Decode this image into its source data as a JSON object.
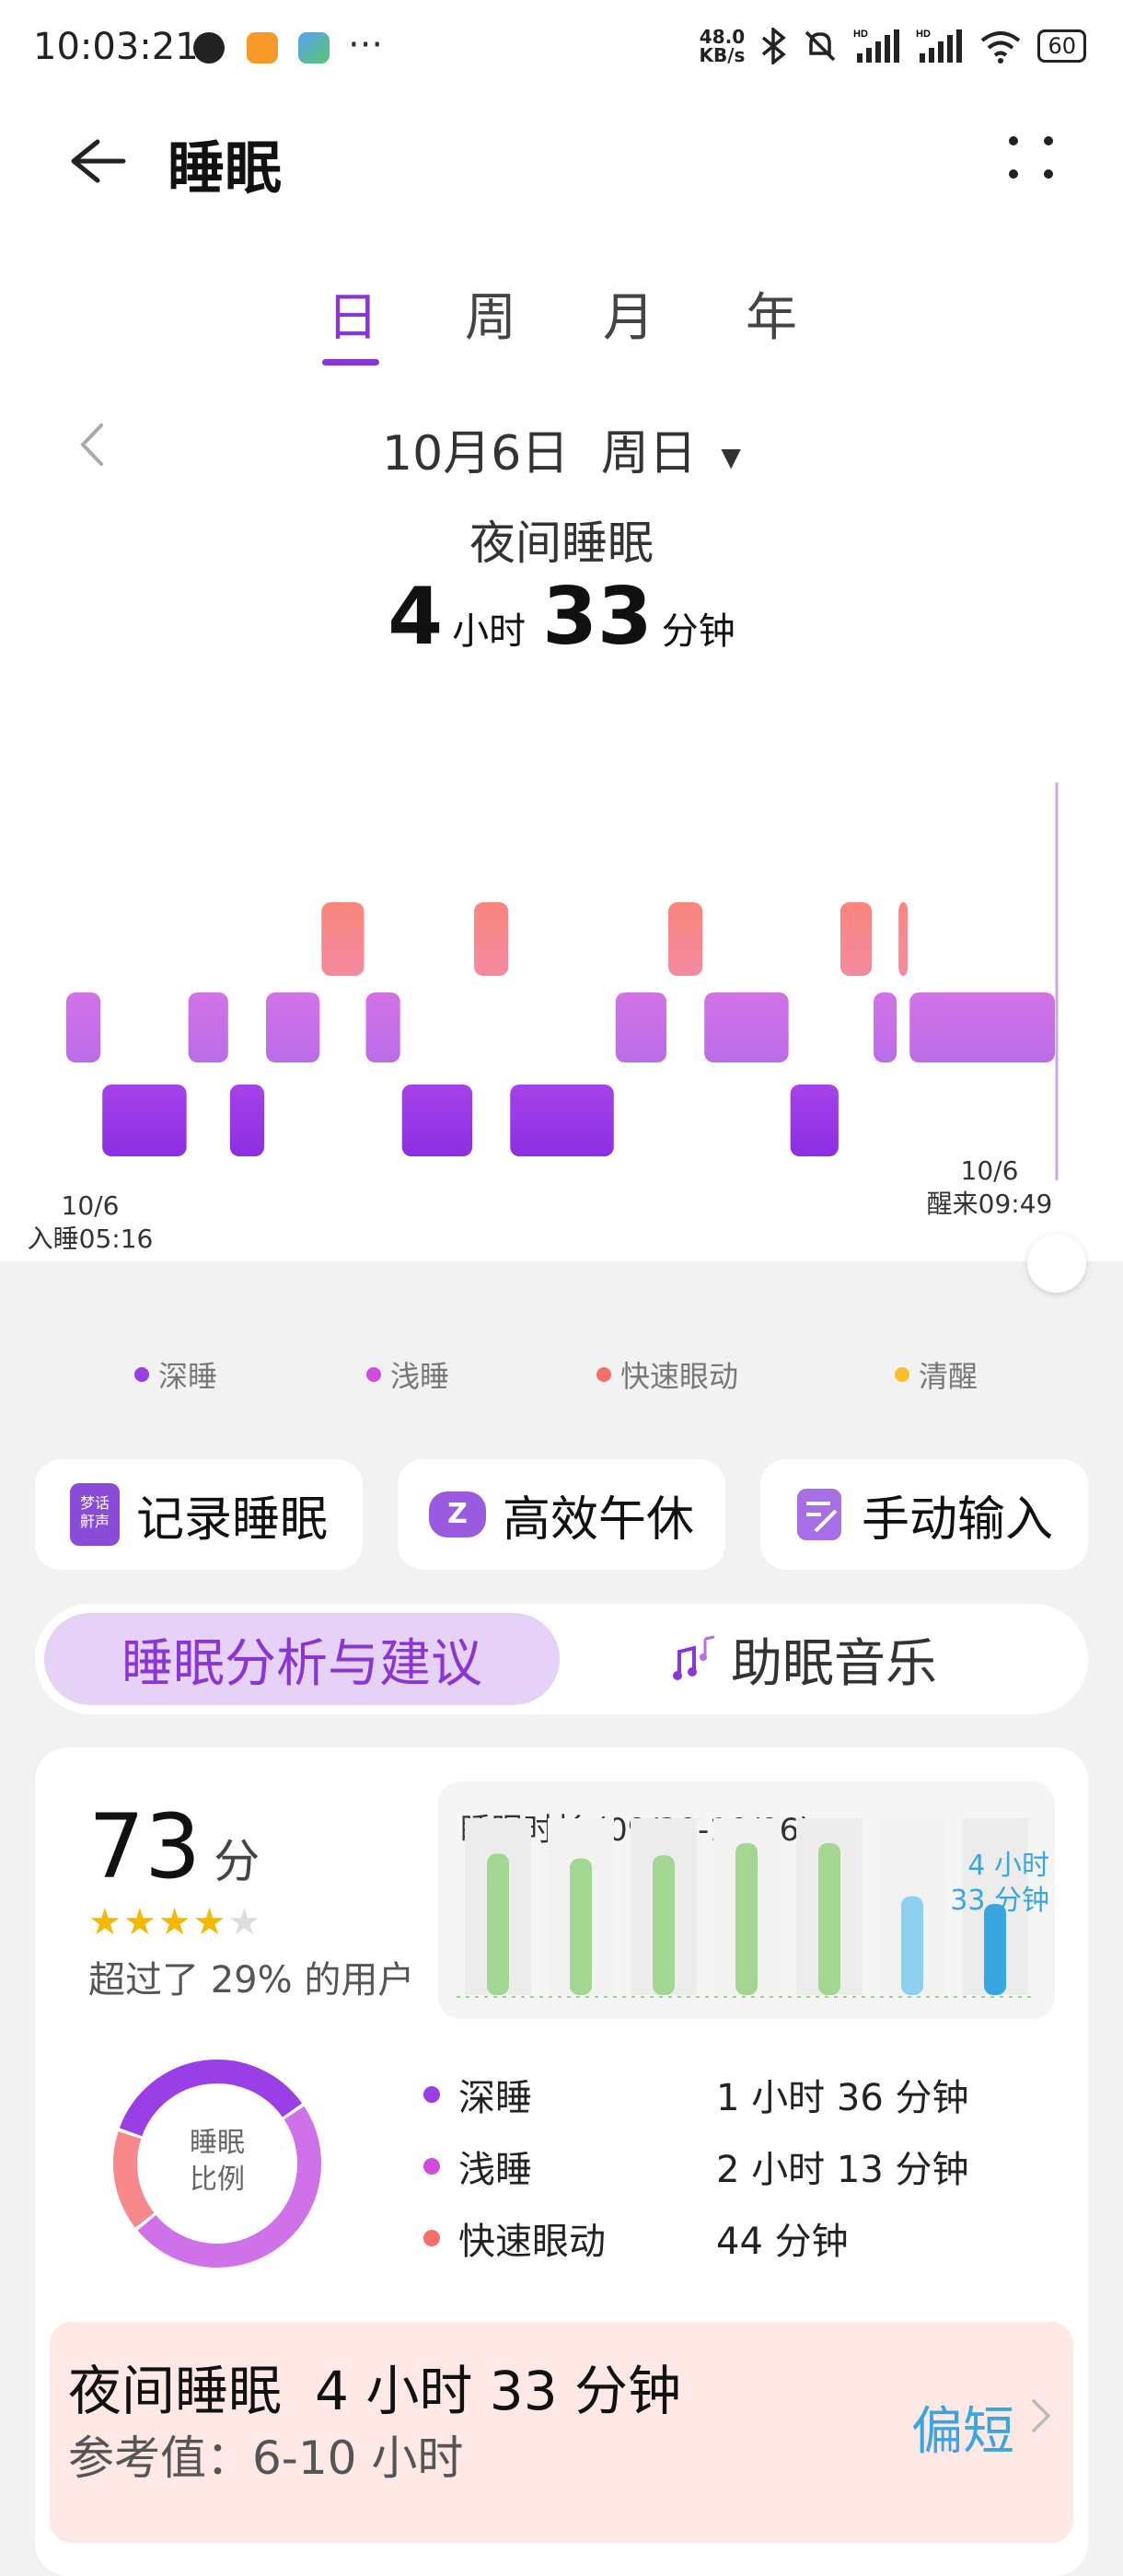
{
  "status_bar": {
    "time": "10:03:21",
    "more": "···",
    "net_speed_value": "48.0",
    "net_speed_unit": "KB/s",
    "icons": [
      "clock-icon",
      "app-icon",
      "gallery-icon",
      "bluetooth-icon",
      "mute-icon",
      "signal-icon",
      "signal-icon",
      "wifi-icon",
      "battery-icon"
    ],
    "battery": "60"
  },
  "header": {
    "title": "睡眠"
  },
  "tabs": [
    {
      "label": "日",
      "active": true
    },
    {
      "label": "周",
      "active": false
    },
    {
      "label": "月",
      "active": false
    },
    {
      "label": "年",
      "active": false
    }
  ],
  "date_nav": {
    "date": "10月6日",
    "weekday": "周日"
  },
  "summary": {
    "subtitle": "夜间睡眠",
    "hours": "4",
    "hours_unit": "小时",
    "minutes": "33",
    "minutes_unit": "分钟"
  },
  "chart_data": {
    "type": "hypnogram",
    "stage_levels": {
      "清醒": 3,
      "快速眼动": 2,
      "浅睡": 1,
      "深睡": 0
    },
    "start_label": {
      "date": "10/6",
      "time": "入睡05:16"
    },
    "end_label": {
      "date": "10/6",
      "time": "醒来09:49"
    },
    "segments": [
      {
        "stage": "浅睡",
        "start": 0,
        "end": 26
      },
      {
        "stage": "深睡",
        "start": 26,
        "end": 88
      },
      {
        "stage": "浅睡",
        "start": 88,
        "end": 118
      },
      {
        "stage": "深睡",
        "start": 118,
        "end": 144
      },
      {
        "stage": "浅睡",
        "start": 144,
        "end": 184
      },
      {
        "stage": "快速眼动",
        "start": 184,
        "end": 216
      },
      {
        "stage": "浅睡",
        "start": 216,
        "end": 242
      },
      {
        "stage": "深睡",
        "start": 242,
        "end": 294
      },
      {
        "stage": "快速眼动",
        "start": 294,
        "end": 320
      },
      {
        "stage": "深睡",
        "start": 320,
        "end": 396
      },
      {
        "stage": "浅睡",
        "start": 396,
        "end": 434
      },
      {
        "stage": "快速眼动",
        "start": 434,
        "end": 460
      },
      {
        "stage": "浅睡",
        "start": 460,
        "end": 522
      },
      {
        "stage": "深睡",
        "start": 522,
        "end": 558
      },
      {
        "stage": "快速眼动",
        "start": 558,
        "end": 582
      },
      {
        "stage": "浅睡",
        "start": 582,
        "end": 600
      },
      {
        "stage": "快速眼动",
        "start": 600,
        "end": 608
      },
      {
        "stage": "浅睡",
        "start": 608,
        "end": 714
      }
    ],
    "colors": {
      "深睡": "#9a3ee6",
      "浅睡": "#cd6fea",
      "快速眼动": "#f8837b",
      "清醒": "#f8be2e"
    }
  },
  "legend": [
    {
      "label": "深睡",
      "color": "#9a3ee6"
    },
    {
      "label": "浅睡",
      "color": "#d14bdc"
    },
    {
      "label": "快速眼动",
      "color": "#f86f6a"
    },
    {
      "label": "清醒",
      "color": "#f8be2e"
    }
  ],
  "actions": [
    {
      "label": "记录睡眠",
      "icon": "dream-talk-icon",
      "icon_text": [
        "梦话",
        "鼾声"
      ]
    },
    {
      "label": "高效午休",
      "icon": "nap-icon"
    },
    {
      "label": "手动输入",
      "icon": "manual-input-icon"
    }
  ],
  "segments": {
    "active": "睡眠分析与建议",
    "inactive": "助眠音乐"
  },
  "analysis": {
    "score": "73",
    "score_unit": "分",
    "stars": 4,
    "stars_total": 5,
    "beat_text": "超过了 29% 的用户",
    "duration_chart": {
      "title": "睡眠时长 (09/30-10/06)",
      "current_label_line1": "4 小时",
      "current_label_line2": "33 分钟",
      "bar_values_relative": [
        0.93,
        0.9,
        0.92,
        1.0,
        1.0,
        0.65,
        0.6
      ],
      "bar_colors": [
        "#a3d593",
        "#a3d593",
        "#a3d593",
        "#a3d593",
        "#a3d593",
        "#8dcfee",
        "#3aa6e0"
      ]
    },
    "ratio_title_line1": "睡眠",
    "ratio_title_line2": "比例",
    "breakdown": [
      {
        "label": "深睡",
        "value": "1 小时 36 分钟",
        "color": "#9a3ee6"
      },
      {
        "label": "浅睡",
        "value": "2 小时 13 分钟",
        "color": "#d14bdc"
      },
      {
        "label": "快速眼动",
        "value": "44 分钟",
        "color": "#f86f6a"
      }
    ],
    "ring_minutes": [
      96,
      133,
      44
    ],
    "night_summary": {
      "title": "夜间睡眠",
      "value": "4 小时 33 分钟",
      "reference": "参考值：6-10 小时",
      "evaluation": "偏短"
    }
  }
}
